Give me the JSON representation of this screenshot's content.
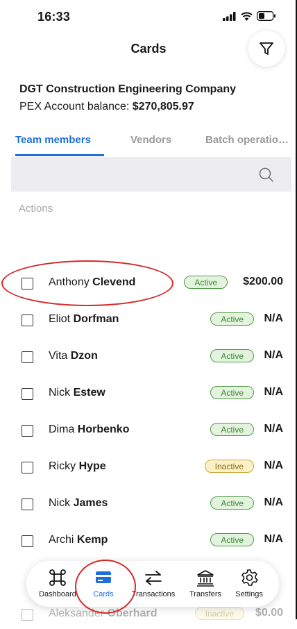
{
  "status_bar": {
    "time": "16:33"
  },
  "header": {
    "title": "Cards"
  },
  "company": {
    "name": "DGT Construction Engineering Company",
    "balance_label": "PEX Account balance:",
    "balance_value": "$270,805.97"
  },
  "tabs": [
    {
      "label": "Team members",
      "active": true
    },
    {
      "label": "Vendors",
      "active": false
    },
    {
      "label": "Batch operatio…",
      "active": false
    }
  ],
  "search": {
    "placeholder": ""
  },
  "actions_label": "Actions",
  "members": [
    {
      "first": "Anthony",
      "last": "Clevend",
      "status": "Active",
      "amount": "$200.00"
    },
    {
      "first": "Eliot",
      "last": "Dorfman",
      "status": "Active",
      "amount": "N/A"
    },
    {
      "first": "Vita",
      "last": "Dzon",
      "status": "Active",
      "amount": "N/A"
    },
    {
      "first": "Nick",
      "last": "Estew",
      "status": "Active",
      "amount": "N/A"
    },
    {
      "first": "Dima",
      "last": "Horbenko",
      "status": "Active",
      "amount": "N/A"
    },
    {
      "first": "Ricky",
      "last": "Hype",
      "status": "Inactive",
      "amount": "N/A"
    },
    {
      "first": "Nick",
      "last": "James",
      "status": "Active",
      "amount": "N/A"
    },
    {
      "first": "Archi",
      "last": "Kemp",
      "status": "Active",
      "amount": "N/A"
    },
    {
      "first": "Aleksander",
      "last": "Oberhard",
      "status": "Inactive",
      "amount": "$0.00"
    }
  ],
  "bottom_nav": [
    {
      "label": "Dashboard",
      "icon": "command-icon",
      "active": false
    },
    {
      "label": "Cards",
      "icon": "card-icon",
      "active": true
    },
    {
      "label": "Transactions",
      "icon": "transfer-arrows-icon",
      "active": false
    },
    {
      "label": "Transfers",
      "icon": "bank-icon",
      "active": false
    },
    {
      "label": "Settings",
      "icon": "gear-icon",
      "active": false
    }
  ],
  "colors": {
    "accent": "#1f6fd8",
    "active_badge_bg": "#e3f3dd",
    "inactive_badge_bg": "#fbf1c8",
    "annotation": "#d42a2a"
  }
}
